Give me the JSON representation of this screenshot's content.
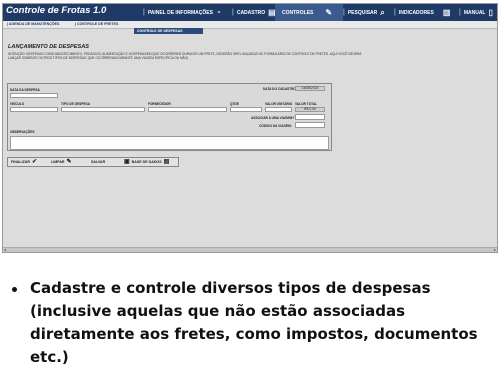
{
  "app": {
    "title": "Controle de Frotas 1.0"
  },
  "nav": [
    {
      "label": "PAINEL DE INFORMAÇÕES",
      "icon": "gauge-icon"
    },
    {
      "label": "CADASTRO",
      "icon": "list-icon"
    },
    {
      "label": "CONTROLES",
      "icon": "pen-icon"
    },
    {
      "label": "PESQUISAR",
      "icon": "search-icon"
    },
    {
      "label": "INDICADORES",
      "icon": "chart-icon"
    },
    {
      "label": "MANUAL",
      "icon": "book-icon"
    }
  ],
  "subtabs": [
    "AGENDA DE MANUTENÇÕES",
    "CONTROLE DE FRETES"
  ],
  "dropdown": {
    "item": "CONTROLE DE DESPESAS"
  },
  "page": {
    "title": "LANÇAMENTO DE DESPESAS",
    "description": "INTENÇÃO: DESPESAS COMO ABASTECIMENTO, PEDÁGIOS, ALIMENTAÇÃO E HOSPEDAGEM QUE OCORREREM DURANTE UM FRETE, DEVERÃO SER LANÇADAS NO FORMULÁRIO DE CONTROLE DE FRETES. AQUI VOCÊ DEVERÁ LANÇAR SOMENTE OUTROS TIPOS DE DESPESAS, QUE OCORRERAM DURANTE UMA VIAGEM ESPECÍFICA OU NÃO)"
  },
  "form": {
    "data_despesa_label": "DATA DA DESPESA",
    "data_cadastro_label": "DATA DO CADASTRO:",
    "data_cadastro_value": "14/08/2024",
    "veiculo_label": "VEÍCULO",
    "tipo_label": "TIPO DE DESPESA",
    "fornecedor_label": "FORNECEDOR",
    "qtde_label": "QTDE",
    "valor_unitario_label": "VALOR UNITÁRIO",
    "valor_total_label": "VALOR TOTAL",
    "valor_total_value": "R$ 0,00",
    "associar_label": "ASSOCIAR A UMA VIAGEM?",
    "codigo_label": "CÓDIGO DA VIAGEM:",
    "observacoes_label": "OBSERVAÇÕES"
  },
  "actions": [
    {
      "label": "FINALIZAR",
      "icon": "check-icon",
      "glyph": "✔"
    },
    {
      "label": "LIMPAR",
      "icon": "broom-icon",
      "glyph": "✎"
    },
    {
      "label": "SALVAR",
      "icon": "save-icon",
      "glyph": "▣"
    },
    {
      "label": "BASE DE DADOS",
      "icon": "database-icon",
      "glyph": "▤"
    }
  ],
  "caption": "Cadastre e controle diversos tipos de despesas (inclusive aquelas que não estão associadas diretamente aos fretes, como impostos, documentos etc.)"
}
